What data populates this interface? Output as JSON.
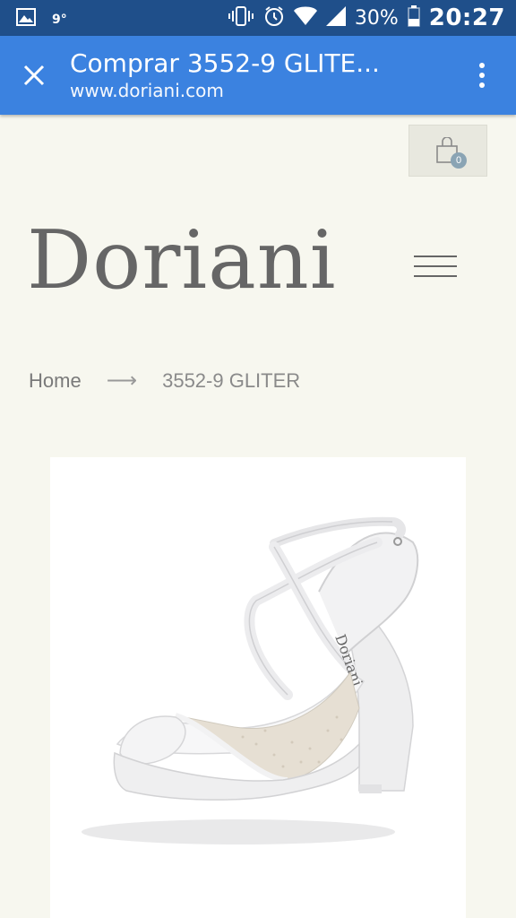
{
  "status_bar": {
    "temperature": "9°",
    "battery": "30%",
    "time": "20:27"
  },
  "toolbar": {
    "title": "Comprar 3552-9 GLITE...",
    "url": "www.doriani.com"
  },
  "cart": {
    "count": "0"
  },
  "brand": {
    "logo_text": "Doriani"
  },
  "breadcrumb": {
    "home": "Home",
    "separator": "⟶",
    "current": "3552-9 GLITER"
  },
  "product": {
    "image_label": "Doriani"
  },
  "colors": {
    "status_bar": "#1f4f8a",
    "toolbar": "#3b82e0",
    "page_bg": "#f7f7ef",
    "cart_badge": "#8aa4b4"
  },
  "icons": [
    "gallery-icon",
    "vibrate-icon",
    "alarm-icon",
    "wifi-icon",
    "signal-icon",
    "battery-icon",
    "close-icon",
    "more-vert-icon",
    "shopping-bag-icon",
    "hamburger-menu-icon"
  ]
}
